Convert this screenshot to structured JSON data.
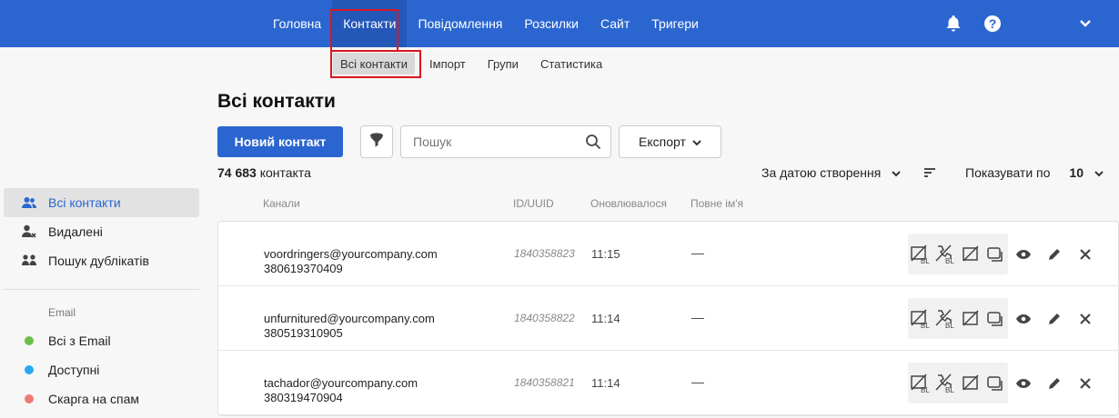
{
  "topnav": {
    "items": [
      {
        "label": "Головна"
      },
      {
        "label": "Контакти",
        "active": true
      },
      {
        "label": "Повідомлення"
      },
      {
        "label": "Розсилки"
      },
      {
        "label": "Сайт"
      },
      {
        "label": "Тригери"
      }
    ],
    "icons": [
      "bell-icon",
      "help-icon",
      "chevron-down-icon"
    ]
  },
  "subnav": {
    "items": [
      {
        "label": "Всі контакти",
        "active": true
      },
      {
        "label": "Імпорт"
      },
      {
        "label": "Групи"
      },
      {
        "label": "Статистика"
      }
    ]
  },
  "sidebar": {
    "items": [
      {
        "label": "Всі контакти",
        "icon": "users-icon",
        "active": true
      },
      {
        "label": "Видалені",
        "icon": "user-remove-icon"
      },
      {
        "label": "Пошук дублікатів",
        "icon": "duplicates-icon"
      }
    ],
    "group_label": "Email",
    "group_items": [
      {
        "label": "Всі з Email",
        "color": "#6cbf4b"
      },
      {
        "label": "Доступні",
        "color": "#2aa8f0"
      },
      {
        "label": "Скарга на спам",
        "color": "#ef7a7a"
      }
    ]
  },
  "main": {
    "title": "Всі контакти",
    "new_contact_button": "Новий контакт",
    "search_placeholder": "Пошук",
    "export_button": "Експорт",
    "count_value": "74 683",
    "count_label": "контакта",
    "sort_label": "За датою створення",
    "per_page_label": "Показувати по",
    "per_page_value": "10"
  },
  "table": {
    "columns": [
      "Канали",
      "ID/UUID",
      "Оновлювалося",
      "Повне ім'я"
    ],
    "rows": [
      {
        "email": "voordringers@yourcompany.com",
        "phone": "380619370409",
        "id": "1840358823",
        "updated": "11:15",
        "name": "—"
      },
      {
        "email": "unfurnitured@yourcompany.com",
        "phone": "380519310905",
        "id": "1840358822",
        "updated": "11:14",
        "name": "—"
      },
      {
        "email": "tachador@yourcompany.com",
        "phone": "380319470904",
        "id": "1840358821",
        "updated": "11:14",
        "name": "—"
      }
    ]
  },
  "colors": {
    "brand": "#2b66d0",
    "highlight": "#d9181e"
  }
}
